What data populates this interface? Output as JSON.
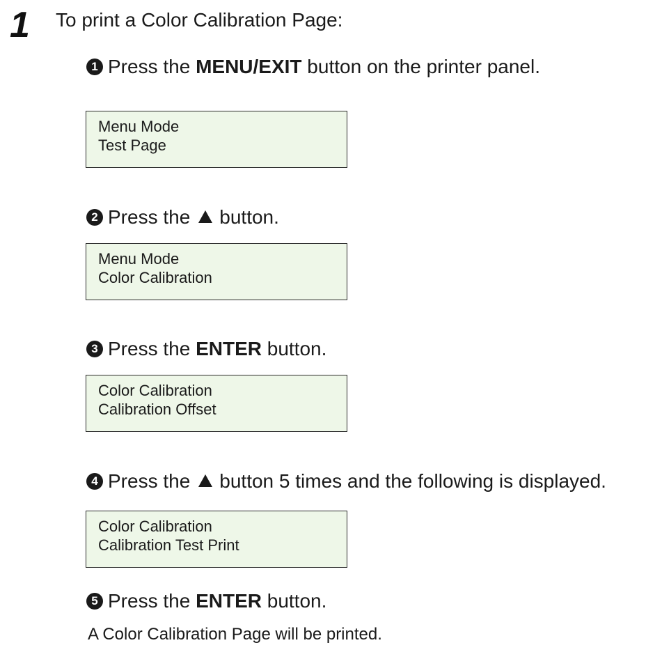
{
  "step": {
    "number": "1",
    "intro": "To print a Color Calibration Page:"
  },
  "substeps": [
    {
      "marker": "1",
      "text_before": "Press the ",
      "bold": "MENU/EXIT",
      "text_after": " button on the printer panel.",
      "display": {
        "line1": "Menu Mode",
        "line2": "Test Page"
      }
    },
    {
      "marker": "2",
      "text_before": "Press the",
      "icon": "up-triangle-icon",
      "text_after": "button.",
      "display": {
        "line1": "Menu Mode",
        "line2": "Color Calibration"
      }
    },
    {
      "marker": "3",
      "text_before": "Press the ",
      "bold": "ENTER",
      "text_after": " button.",
      "display": {
        "line1": "Color Calibration",
        "line2": "Calibration Offset"
      }
    },
    {
      "marker": "4",
      "text_before": "Press the",
      "icon": "up-triangle-icon",
      "text_after": "button 5 times and the following is displayed.",
      "display": {
        "line1": "Color Calibration",
        "line2": "Calibration Test Print"
      }
    },
    {
      "marker": "5",
      "text_before": "Press the ",
      "bold": "ENTER",
      "text_after": " button."
    }
  ],
  "result": "A Color Calibration Page will be printed.",
  "colors": {
    "lcd_background": "#eef7e8",
    "text": "#1a1a1a"
  }
}
